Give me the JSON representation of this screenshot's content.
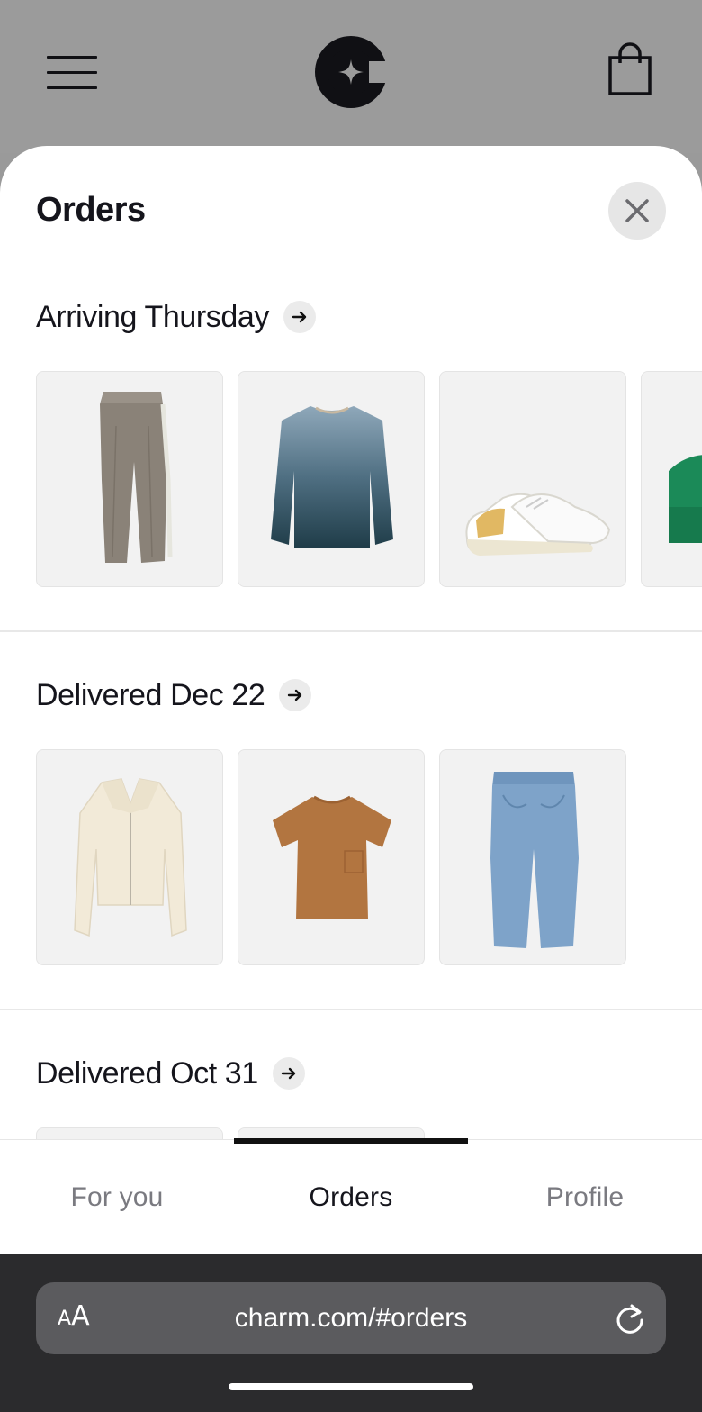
{
  "header": {
    "menu_icon": "hamburger-menu-icon",
    "logo_icon": "charm-logo",
    "bag_icon": "shopping-bag-icon"
  },
  "sheet": {
    "title": "Orders",
    "close_icon": "close-icon"
  },
  "sections": [
    {
      "label": "Arriving Thursday",
      "items": [
        "pleated-trousers",
        "gradient-sweater",
        "white-sneakers",
        "green-beanie"
      ]
    },
    {
      "label": "Delivered Dec 22",
      "items": [
        "cream-zip-cardigan",
        "brown-pocket-tee",
        "light-wash-jeans"
      ]
    },
    {
      "label": "Delivered Oct 31",
      "items": []
    }
  ],
  "tabs": [
    {
      "label": "For you",
      "active": false
    },
    {
      "label": "Orders",
      "active": true
    },
    {
      "label": "Profile",
      "active": false
    }
  ],
  "browser": {
    "text_size_small": "A",
    "text_size_big": "A",
    "url": "charm.com/#orders",
    "reload_icon": "reload-icon"
  },
  "colors": {
    "accent": "#111111",
    "sheet_bg": "#ffffff",
    "dim_bg": "#9b9b9b",
    "tile_bg": "#f2f2f2"
  }
}
